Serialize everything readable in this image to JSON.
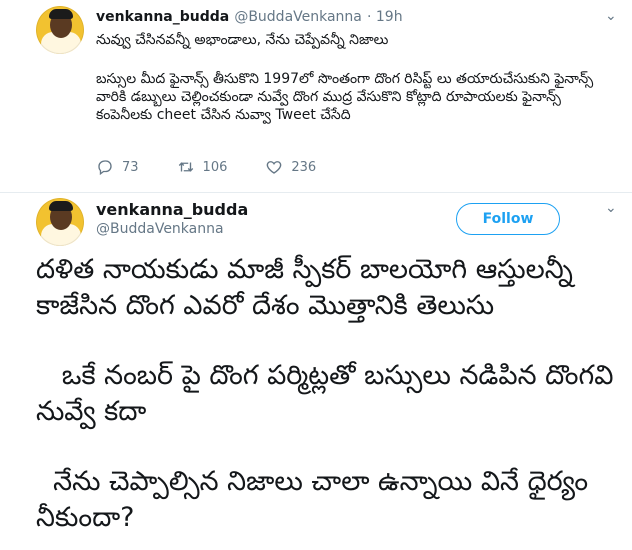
{
  "tweet1": {
    "author_name": "venkanna_budda",
    "author_handle": "@BuddaVenkanna",
    "time": "· 19h",
    "text": "నువ్వు చేసినవన్నీ అభాండాలు, నేను చెప్పేవన్నీ నిజాలు",
    "quote_text": "బస్సుల మీద ఫైనాన్స్ తీసుకొని 1997లో సొంతంగా దొంగ రిసిప్ట్ లు తయారుచేసుకుని ఫైనాన్స్ వారికి డబ్బులు చెల్లించకుండా నువ్వే దొంగ ముద్ర వేసుకొని కోట్లాది రూపాయలకు ఫైనాన్స్ కంపెనీలకు cheet చేసిన నువ్వా Tweet చేసేది",
    "reply_count": "73",
    "retweet_count": "106",
    "like_count": "236"
  },
  "tweet2": {
    "author_name": "venkanna_budda",
    "author_handle": "@BuddaVenkanna",
    "follow_label": "Follow",
    "paragraph1": "దళిత నాయకుడు మాజీ స్పీకర్ బాలయోగి ఆస్తులన్నీ కాజేసిన దొంగ ఎవరో దేశం మొత్తానికి తెలుసు",
    "paragraph2": "   ఒకే నంబర్ పై దొంగ పర్మిట్లతో బస్సులు నడిపిన దొంగవి నువ్వే కదా",
    "paragraph3": "  నేను చెప్పాల్సిన నిజాలు చాలా ఉన్నాయి వినే ధైర్యం నీకుందా?"
  },
  "icons": {
    "caret": "chevron-down-icon",
    "reply": "reply-icon",
    "retweet": "retweet-icon",
    "like": "heart-icon"
  },
  "colors": {
    "accent": "#1da1f2",
    "muted": "#657786",
    "text": "#14171a",
    "avatar_bg": "#f2c230"
  }
}
